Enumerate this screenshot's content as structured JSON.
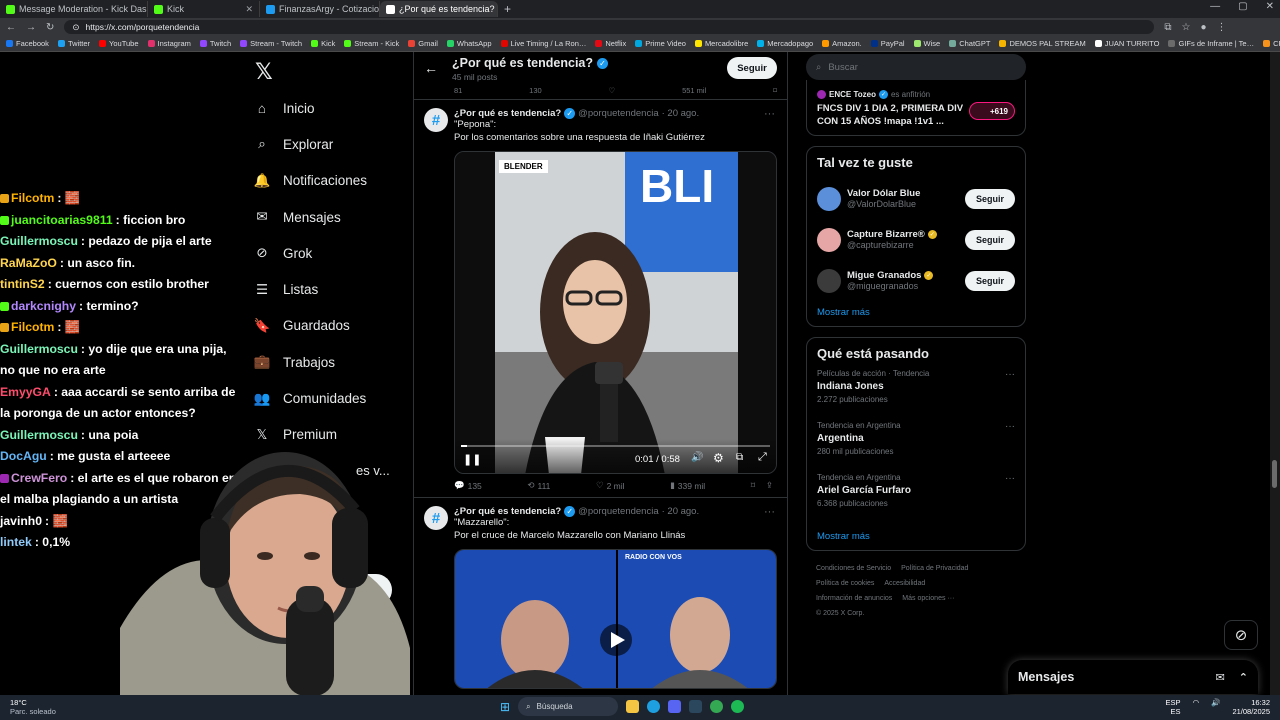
{
  "browser": {
    "tabs": [
      {
        "title": "Message Moderation - Kick Dash",
        "color": "#53fc18",
        "active": false
      },
      {
        "title": "Kick",
        "color": "#53fc18",
        "active": false
      },
      {
        "title": "FinanzasArgy - Cotizaciones en ti",
        "color": "#1d9bf0",
        "active": false
      },
      {
        "title": "¿Por qué es tendencia? (@p",
        "color": "#ffffff",
        "active": true
      }
    ],
    "new_tab": "+",
    "url": "https://x.com/porquetendencia",
    "bookmarks": [
      "Facebook",
      "Twitter",
      "YouTube",
      "Instagram",
      "Twitch",
      "Stream - Twitch",
      "Kick",
      "Stream - Kick",
      "Gmail",
      "WhatsApp",
      "Live Timing / La Ron…",
      "Netflix",
      "Prime Video",
      "Mercadolibre",
      "Mercadopago",
      "Amazon.",
      "PayPal",
      "Wise",
      "ChatGPT",
      "DEMOS PAL STREAM",
      "JUAN TURRITO",
      "GIFs de Inframe | Te…",
      "CRIPTO",
      "aires",
      "EL MEGA PACK PAP…"
    ]
  },
  "chat": [
    {
      "user": "Filcotm",
      "color": "#ffb300",
      "msg": "🧱",
      "badge": "#e8a317"
    },
    {
      "user": "juancitoarias9811",
      "color": "#53fc18",
      "msg": "ficcion bro",
      "badge": "#53fc18"
    },
    {
      "user": "Guillermoscu",
      "color": "#7bf5b8",
      "msg": "pedazo de pija el arte",
      "badge": ""
    },
    {
      "user": "RaMaZoO",
      "color": "#ffd54f",
      "msg": "un asco fin.",
      "badge": ""
    },
    {
      "user": "tintinS2",
      "color": "#ffd54f",
      "msg": "cuernos con estilo brother",
      "badge": ""
    },
    {
      "user": "darkcnighy",
      "color": "#b388ff",
      "msg": "termino?",
      "badge": "#53fc18"
    },
    {
      "user": "Filcotm",
      "color": "#ffb300",
      "msg": "🧱",
      "badge": "#e8a317"
    },
    {
      "user": "Guillermoscu",
      "color": "#7bf5b8",
      "msg": "yo dije que era una pija, no que no era arte",
      "badge": ""
    },
    {
      "user": "EmyyGA",
      "color": "#ff4d6d",
      "msg": "aaa accardi se sento arriba de la poronga de un actor entonces?",
      "badge": ""
    },
    {
      "user": "Guillermoscu",
      "color": "#7bf5b8",
      "msg": "una poia",
      "badge": ""
    },
    {
      "user": "DocAgu",
      "color": "#64b5f6",
      "msg": "me gusta el arteeee",
      "badge": ""
    },
    {
      "user": "CrewFero",
      "color": "#ce93d8",
      "msg": "el arte es el que robaron en el malba plagiando a un artista",
      "badge": "#9c27b0"
    },
    {
      "user": "javinh0",
      "color": "#ffffff",
      "msg": "🧱",
      "badge": ""
    },
    {
      "user": "lintek",
      "color": "#90caf9",
      "msg": "0,1%",
      "badge": ""
    }
  ],
  "nav": {
    "items": [
      {
        "label": "Inicio",
        "icon": "home-icon",
        "glyph": "⌂"
      },
      {
        "label": "Explorar",
        "icon": "search-icon",
        "glyph": "⌕"
      },
      {
        "label": "Notificaciones",
        "icon": "bell-icon",
        "glyph": "🔔"
      },
      {
        "label": "Mensajes",
        "icon": "mail-icon",
        "glyph": "✉"
      },
      {
        "label": "Grok",
        "icon": "grok-icon",
        "glyph": "⊘"
      },
      {
        "label": "Listas",
        "icon": "list-icon",
        "glyph": "☰"
      },
      {
        "label": "Guardados",
        "icon": "bookmark-icon",
        "glyph": "🔖"
      },
      {
        "label": "Trabajos",
        "icon": "briefcase-icon",
        "glyph": "💼"
      },
      {
        "label": "Comunidades",
        "icon": "communities-icon",
        "glyph": "👥"
      },
      {
        "label": "Premium",
        "icon": "x-icon",
        "glyph": "𝕏"
      }
    ],
    "partial_more": "es v...",
    "partial_options": "ones",
    "post_fragment": "ear",
    "more_dots": "···"
  },
  "timeline": {
    "title": "¿Por qué es tendencia?",
    "posts_count": "45 mil posts",
    "follow_label": "Seguir",
    "prev_stats": [
      "81",
      "130",
      "",
      "551 mil"
    ],
    "tweets": [
      {
        "name": "¿Por qué es tendencia?",
        "handle": "@porquetendencia",
        "date": "· 20 ago.",
        "line1": "\"Pepona\":",
        "line2": "Por los comentarios sobre una respuesta de Iñaki Gutiérrez",
        "overlay": "BLENDER",
        "time": "0:01 / 0:58",
        "progress": 0.02,
        "stats": {
          "replies": "135",
          "reposts": "111",
          "likes": "2 mil",
          "views": "339 mil"
        }
      },
      {
        "name": "¿Por qué es tendencia?",
        "handle": "@porquetendencia",
        "date": "· 20 ago.",
        "line1": "\"Mazzarello\":",
        "line2": "Por el cruce de Marcelo Mazzarello con Mariano Llinás",
        "overlay": "RADIO CON VOS"
      }
    ]
  },
  "sidebar": {
    "search_placeholder": "Buscar",
    "space": {
      "host": "ENCE Tozeo",
      "host_suffix": "es anfitrión",
      "title": "FNCS DIV 1 DIA 2, PRIMERA DIV CON 15 AÑOS !mapa !1v1 ...",
      "listeners": "+619"
    },
    "who_to_follow": {
      "title": "Tal vez te guste",
      "users": [
        {
          "name": "Valor Dólar Blue",
          "handle": "@ValorDolarBlue",
          "verified": false,
          "color": "#5b8fd9"
        },
        {
          "name": "Capture Bizarre®",
          "handle": "@capturebizarre",
          "verified": true,
          "color": "#e6a6a6"
        },
        {
          "name": "Migue Granados",
          "handle": "@miguegranados",
          "verified": true,
          "color": "#3b3b3b"
        }
      ],
      "follow_label": "Seguir",
      "more": "Mostrar más"
    },
    "trends": {
      "title": "Qué está pasando",
      "items": [
        {
          "ctx": "Películas de acción · Tendencia",
          "name": "Indiana Jones",
          "count": "2.272 publicaciones"
        },
        {
          "ctx": "Tendencia en Argentina",
          "name": "Argentina",
          "count": "280 mil publicaciones"
        },
        {
          "ctx": "Tendencia en Argentina",
          "name": "Ariel García Furfaro",
          "count": "6.368 publicaciones"
        }
      ],
      "more": "Mostrar más"
    },
    "footer": [
      "Condiciones de Servicio",
      "Política de Privacidad",
      "Política de cookies",
      "Accesibilidad",
      "Información de anuncios",
      "Más opciones ···",
      "© 2025 X Corp."
    ]
  },
  "messages_dock": {
    "title": "Mensajes"
  },
  "taskbar": {
    "temp": "18°C",
    "weather": "Parc. soleado",
    "search": "Búsqueda",
    "lang": "ESP",
    "lang2": "ES",
    "time": "16:32",
    "date": "21/08/2025"
  }
}
